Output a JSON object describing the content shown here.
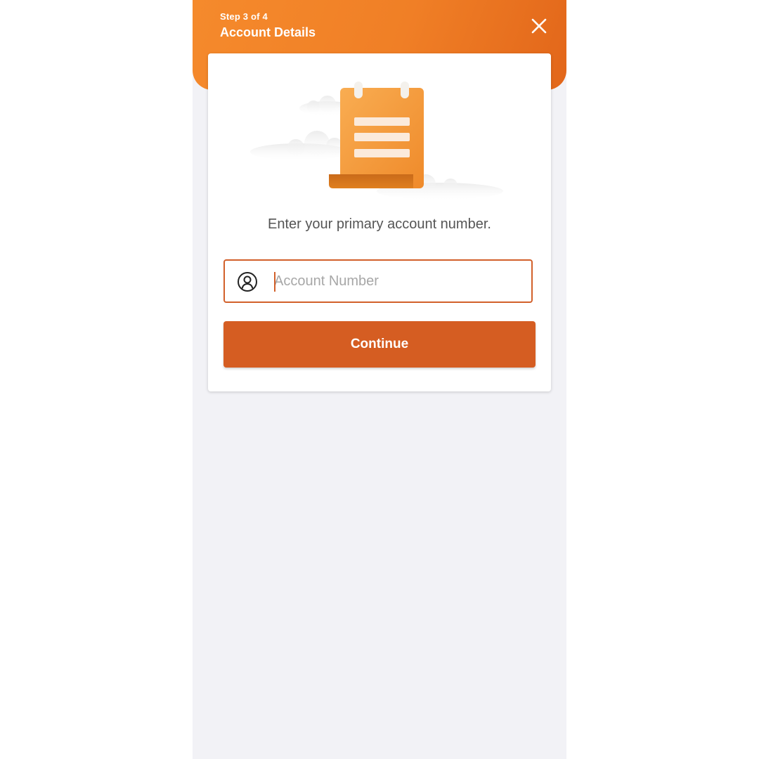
{
  "header": {
    "step_text": "Step 3 of 4",
    "title": "Account Details",
    "close_icon": "close-icon"
  },
  "card": {
    "illustration": "notepad-document-icon",
    "prompt": "Enter your primary account number.",
    "account_field": {
      "icon": "user-circle-icon",
      "placeholder": "Account Number",
      "value": ""
    },
    "continue_label": "Continue"
  },
  "colors": {
    "header_gradient_start": "#f58a2c",
    "header_gradient_end": "#e2661a",
    "accent": "#d55d22",
    "background": "#f2f2f6"
  }
}
